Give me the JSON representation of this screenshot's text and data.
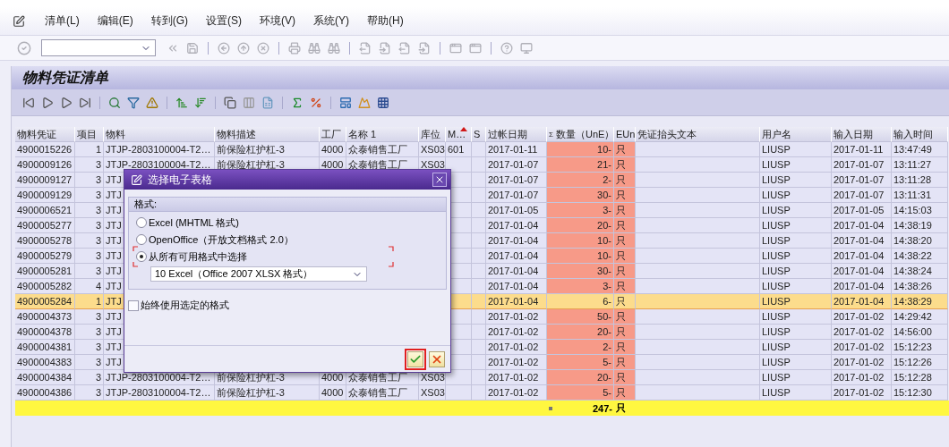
{
  "menu": [
    "清单(L)",
    "编辑(E)",
    "转到(G)",
    "设置(S)",
    "环境(V)",
    "系统(Y)",
    "帮助(H)"
  ],
  "screen_title": "物料凭证清单",
  "table": {
    "columns": [
      {
        "label": "物料凭证",
        "sorted": false,
        "highlighted": false
      },
      {
        "label": "项目",
        "sorted": false,
        "highlighted": false
      },
      {
        "label": "物料",
        "sorted": false,
        "highlighted": false
      },
      {
        "label": "物料描述",
        "sorted": false,
        "highlighted": false
      },
      {
        "label": "工厂",
        "sorted": false,
        "highlighted": false
      },
      {
        "label": "名称 1",
        "sorted": false,
        "highlighted": false
      },
      {
        "label": "库位",
        "sorted": false,
        "highlighted": false
      },
      {
        "label": "M…",
        "sorted": true,
        "highlighted": false
      },
      {
        "label": "S",
        "sorted": false,
        "highlighted": false
      },
      {
        "label": "过帐日期",
        "sorted": false,
        "highlighted": false
      },
      {
        "label": "数量（UnE）",
        "sum_mark": "Σ",
        "sorted": false,
        "highlighted": true
      },
      {
        "label": "EUn",
        "sorted": false,
        "highlighted": true
      },
      {
        "label": "凭证抬头文本",
        "sorted": false,
        "highlighted": false
      },
      {
        "label": "用户名",
        "sorted": false,
        "highlighted": false
      },
      {
        "label": "输入日期",
        "sorted": false,
        "highlighted": false
      },
      {
        "label": "输入时间",
        "sorted": false,
        "highlighted": false
      }
    ],
    "rows": [
      {
        "selected": false,
        "doc": "4900015226",
        "item": "1",
        "material": "JTJP-2803100004-T2…",
        "description": "前保险杠护杠-3",
        "plant": "4000",
        "plant_name": "众泰销售工厂",
        "location": "XS03",
        "movement": "601",
        "posting_date": "2017-01-11",
        "quantity": "10-",
        "unit": "只",
        "user": "LIUSP",
        "entry_date": "2017-01-11",
        "entry_time": "13:47:49"
      },
      {
        "selected": false,
        "doc": "4900009126",
        "item": "3",
        "material": "JTJP-2803100004-T2…",
        "description": "前保险杠护杠-3",
        "plant": "4000",
        "plant_name": "众泰销售工厂",
        "location": "XS03",
        "posting_date": "2017-01-07",
        "quantity": "21-",
        "unit": "只",
        "user": "LIUSP",
        "entry_date": "2017-01-07",
        "entry_time": "13:11:27"
      },
      {
        "selected": false,
        "doc": "4900009127",
        "item": "3",
        "material": "JTJ",
        "posting_date": "2017-01-07",
        "quantity": "2-",
        "unit": "只",
        "user": "LIUSP",
        "entry_date": "2017-01-07",
        "entry_time": "13:11:28"
      },
      {
        "selected": false,
        "doc": "4900009129",
        "item": "3",
        "material": "JTJ",
        "posting_date": "2017-01-07",
        "quantity": "30-",
        "unit": "只",
        "user": "LIUSP",
        "entry_date": "2017-01-07",
        "entry_time": "13:11:31"
      },
      {
        "selected": false,
        "doc": "4900006521",
        "item": "3",
        "material": "JTJ",
        "posting_date": "2017-01-05",
        "quantity": "3-",
        "unit": "只",
        "user": "LIUSP",
        "entry_date": "2017-01-05",
        "entry_time": "14:15:03"
      },
      {
        "selected": false,
        "doc": "4900005277",
        "item": "3",
        "material": "JTJ",
        "posting_date": "2017-01-04",
        "quantity": "20-",
        "unit": "只",
        "user": "LIUSP",
        "entry_date": "2017-01-04",
        "entry_time": "14:38:19"
      },
      {
        "selected": false,
        "doc": "4900005278",
        "item": "3",
        "material": "JTJ",
        "posting_date": "2017-01-04",
        "quantity": "10-",
        "unit": "只",
        "user": "LIUSP",
        "entry_date": "2017-01-04",
        "entry_time": "14:38:20"
      },
      {
        "selected": false,
        "doc": "4900005279",
        "item": "3",
        "material": "JTJ",
        "posting_date": "2017-01-04",
        "quantity": "10-",
        "unit": "只",
        "user": "LIUSP",
        "entry_date": "2017-01-04",
        "entry_time": "14:38:22"
      },
      {
        "selected": false,
        "doc": "4900005281",
        "item": "3",
        "material": "JTJ",
        "posting_date": "2017-01-04",
        "quantity": "30-",
        "unit": "只",
        "user": "LIUSP",
        "entry_date": "2017-01-04",
        "entry_time": "14:38:24"
      },
      {
        "selected": false,
        "doc": "4900005282",
        "item": "4",
        "material": "JTJ",
        "posting_date": "2017-01-04",
        "quantity": "3-",
        "unit": "只",
        "user": "LIUSP",
        "entry_date": "2017-01-04",
        "entry_time": "14:38:26"
      },
      {
        "selected": true,
        "doc": "4900005284",
        "item": "1",
        "material": "JTJ",
        "posting_date": "2017-01-04",
        "quantity": "6-",
        "unit": "只",
        "user": "LIUSP",
        "entry_date": "2017-01-04",
        "entry_time": "14:38:29"
      },
      {
        "selected": false,
        "doc": "4900004373",
        "item": "3",
        "material": "JTJ",
        "posting_date": "2017-01-02",
        "quantity": "50-",
        "unit": "只",
        "user": "LIUSP",
        "entry_date": "2017-01-02",
        "entry_time": "14:29:42"
      },
      {
        "selected": false,
        "doc": "4900004378",
        "item": "3",
        "material": "JTJ",
        "posting_date": "2017-01-02",
        "quantity": "20-",
        "unit": "只",
        "user": "LIUSP",
        "entry_date": "2017-01-02",
        "entry_time": "14:56:00"
      },
      {
        "selected": false,
        "doc": "4900004381",
        "item": "3",
        "material": "JTJ",
        "posting_date": "2017-01-02",
        "quantity": "2-",
        "unit": "只",
        "user": "LIUSP",
        "entry_date": "2017-01-02",
        "entry_time": "15:12:23"
      },
      {
        "selected": false,
        "doc": "4900004383",
        "item": "3",
        "material": "JTJ",
        "posting_date": "2017-01-02",
        "quantity": "5-",
        "unit": "只",
        "user": "LIUSP",
        "entry_date": "2017-01-02",
        "entry_time": "15:12:26"
      },
      {
        "selected": false,
        "doc": "4900004384",
        "item": "3",
        "material": "JTJP-2803100004-T2…",
        "description": "前保险杠护杠-3",
        "plant": "4000",
        "plant_name": "众泰销售工厂",
        "location": "XS03",
        "posting_date": "2017-01-02",
        "quantity": "20-",
        "unit": "只",
        "user": "LIUSP",
        "entry_date": "2017-01-02",
        "entry_time": "15:12:28"
      },
      {
        "selected": false,
        "doc": "4900004386",
        "item": "3",
        "material": "JTJP-2803100004-T2…",
        "description": "前保险杠护杠-3",
        "plant": "4000",
        "plant_name": "众泰销售工厂",
        "location": "XS03",
        "posting_date": "2017-01-02",
        "quantity": "5-",
        "unit": "只",
        "user": "LIUSP",
        "entry_date": "2017-01-02",
        "entry_time": "15:12:30"
      }
    ],
    "total": {
      "quantity": "247-",
      "unit": "只"
    }
  },
  "dialog": {
    "title": "选择电子表格",
    "group_label": "格式:",
    "options": [
      {
        "label": "Excel (MHTML 格式)",
        "selected": false
      },
      {
        "label": "OpenOffice（开放文档格式 2.0）",
        "selected": false
      },
      {
        "label": "从所有可用格式中选择",
        "selected": true
      }
    ],
    "format_dropdown": "10 Excel（Office 2007 XLSX 格式）",
    "always_use": {
      "label": "始终使用选定的格式",
      "checked": false
    },
    "ok_focused": true
  }
}
